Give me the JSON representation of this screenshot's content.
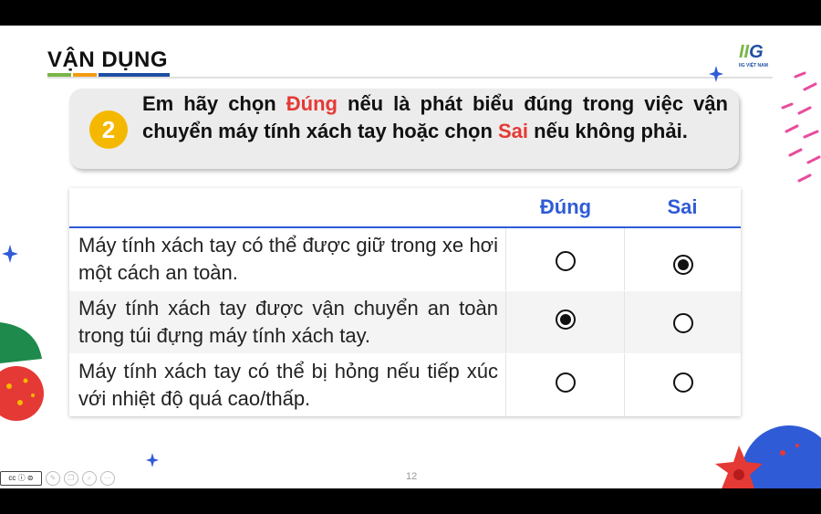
{
  "slide": {
    "title": "VẬN DỤNG",
    "logo_text_a": "II",
    "logo_text_b": "G",
    "logo_sub": "IIG VIỆT NAM",
    "page_number": "12"
  },
  "question": {
    "number": "2",
    "text_part1": "Em hãy chọn ",
    "highlight_true": "Đúng",
    "text_part2": " nếu là phát biểu đúng trong việc vận chuyển máy tính xách tay hoặc chọn ",
    "highlight_false": "Sai",
    "text_part3": " nếu không phải."
  },
  "table": {
    "col_true": "Đúng",
    "col_false": "Sai",
    "rows": [
      {
        "statement": "Máy tính xách tay có thể được giữ trong xe hơi một cách an toàn.",
        "true_selected": false,
        "false_selected": true
      },
      {
        "statement": "Máy tính xách tay được vận chuyển an toàn trong túi đựng máy tính xách tay.",
        "true_selected": true,
        "false_selected": false
      },
      {
        "statement": "Máy tính xách tay có thể bị hỏng nếu tiếp xúc với nhiệt độ quá cao/thấp.",
        "true_selected": false,
        "false_selected": false
      }
    ]
  },
  "toolbar": {
    "cc_label": "cc ⓘ ⊜",
    "icons": [
      "pen-icon",
      "copy-icon",
      "zoom-icon",
      "more-icon"
    ]
  },
  "colors": {
    "accent_blue": "#2f5bd6",
    "accent_red": "#e53935",
    "badge_yellow": "#f5b800"
  }
}
